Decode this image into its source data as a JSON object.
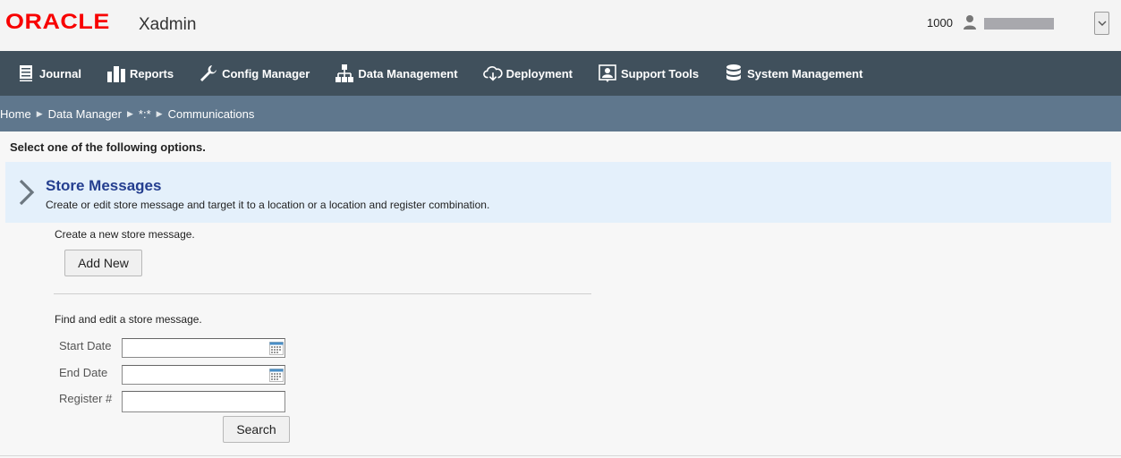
{
  "header": {
    "logo": "ORACLE",
    "app_name": "Xadmin",
    "store_number": "1000",
    "user_icon": "user-icon",
    "menu_icon": "chevron-down-icon"
  },
  "nav": {
    "items": [
      {
        "label": "Journal",
        "icon": "journal-icon"
      },
      {
        "label": "Reports",
        "icon": "bar-chart-icon"
      },
      {
        "label": "Config Manager",
        "icon": "wrench-icon"
      },
      {
        "label": "Data Management",
        "icon": "hierarchy-icon"
      },
      {
        "label": "Deployment",
        "icon": "cloud-download-icon"
      },
      {
        "label": "Support Tools",
        "icon": "support-icon"
      },
      {
        "label": "System Management",
        "icon": "database-icon"
      }
    ]
  },
  "breadcrumb": {
    "items": [
      "Home",
      "Data Manager",
      "*:*",
      "Communications"
    ]
  },
  "content": {
    "instruction": "Select one of the following options.",
    "section": {
      "title": "Store Messages",
      "description": "Create or edit store message and target it to a location or a location and register combination."
    },
    "create_label": "Create a new store message.",
    "add_new_button": "Add New",
    "find_label": "Find and edit a store message.",
    "fields": {
      "start_date": {
        "label": "Start Date",
        "value": ""
      },
      "end_date": {
        "label": "End Date",
        "value": ""
      },
      "register": {
        "label": "Register #",
        "value": ""
      }
    },
    "search_button": "Search"
  },
  "colors": {
    "oracle_red": "#f80000",
    "nav_bg": "#40505c",
    "breadcrumb_bg": "#5f778d",
    "panel_bg": "#e4f0fb",
    "panel_title": "#243e8f"
  }
}
